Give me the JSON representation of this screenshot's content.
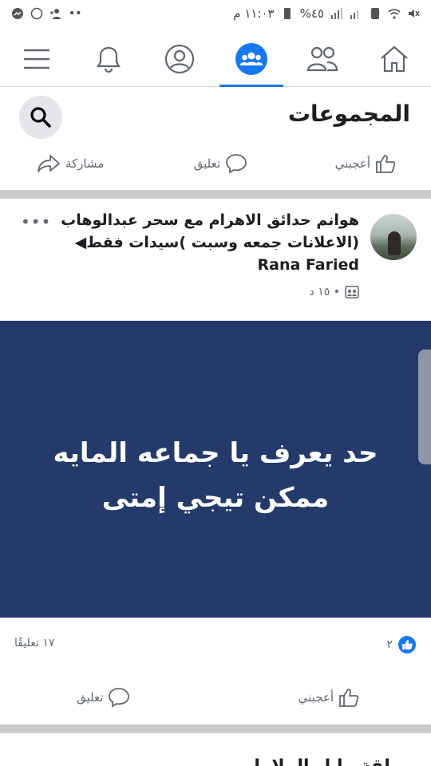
{
  "status_bar": {
    "time": "١١:٠٣ م",
    "battery": "%٤٥"
  },
  "nav": {
    "items": [
      "menu",
      "notifications",
      "profile",
      "groups",
      "friends",
      "home"
    ],
    "active": "groups"
  },
  "header": {
    "title": "المجموعات"
  },
  "top_actions": {
    "like": "أعجبني",
    "comment": "تعليق",
    "share": "مشاركة"
  },
  "post": {
    "group": "هوانم حدائق الاهرام  مع سحر عبدالوهاب (الاعلانات جمعه وسبت )سيدات فقط◀",
    "author": "Rana Faried",
    "time": "١٥ د •",
    "more": "•••",
    "banner_line1": "حد يعرف يا جماعه المايه",
    "banner_line2": "ممكن تيجي إمتى",
    "banner_color": "#243a6a",
    "likes": "٢",
    "comments": "١٧ تعليقًا",
    "like_label": "أعجبني",
    "comment_label": "تعليق"
  },
  "next_post": {
    "title_fragment": "...لقة ما ل الملاما"
  },
  "colors": {
    "accent": "#1877f2",
    "separator": "#cccccc"
  }
}
